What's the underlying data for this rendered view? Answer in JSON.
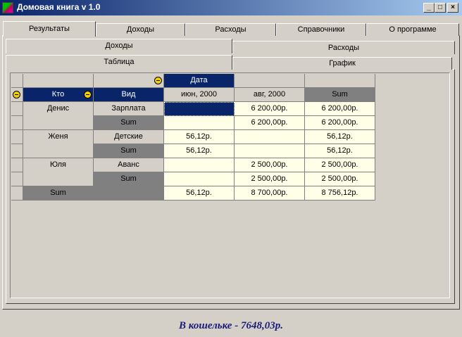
{
  "window": {
    "title": "Домовая книга v 1.0",
    "controls": [
      "_",
      "□",
      "×"
    ]
  },
  "main_tabs": [
    "Результаты",
    "Доходы",
    "Расходы",
    "Справочники",
    "О программе"
  ],
  "sub_tabs_row1": [
    "Доходы",
    "Расходы"
  ],
  "sub_tabs_row2": [
    "Таблица",
    "График"
  ],
  "grid": {
    "column_field": "Дата",
    "row_fields": [
      "Кто",
      "Вид"
    ],
    "col_headers": [
      "июн, 2000",
      "авг, 2000",
      "Sum"
    ],
    "rows": [
      {
        "who": "Денис",
        "kind": "Зарплата",
        "jun": "",
        "aug": "6 200,00р.",
        "sum": "6 200,00р."
      },
      {
        "who": "",
        "kind": "Sum",
        "jun": "",
        "aug": "6 200,00р.",
        "sum": "6 200,00р."
      },
      {
        "who": "Женя",
        "kind": "Детские",
        "jun": "56,12р.",
        "aug": "",
        "sum": "56,12р."
      },
      {
        "who": "",
        "kind": "Sum",
        "jun": "56,12р.",
        "aug": "",
        "sum": "56,12р."
      },
      {
        "who": "Юля",
        "kind": "Аванс",
        "jun": "",
        "aug": "2 500,00р.",
        "sum": "2 500,00р."
      },
      {
        "who": "",
        "kind": "Sum",
        "jun": "",
        "aug": "2 500,00р.",
        "sum": "2 500,00р."
      },
      {
        "who": "Sum",
        "kind": "",
        "jun": "56,12р.",
        "aug": "8 700,00р.",
        "sum": "8 756,12р."
      }
    ]
  },
  "status": {
    "wallet_text": "В кошельке - 7648,03р."
  }
}
